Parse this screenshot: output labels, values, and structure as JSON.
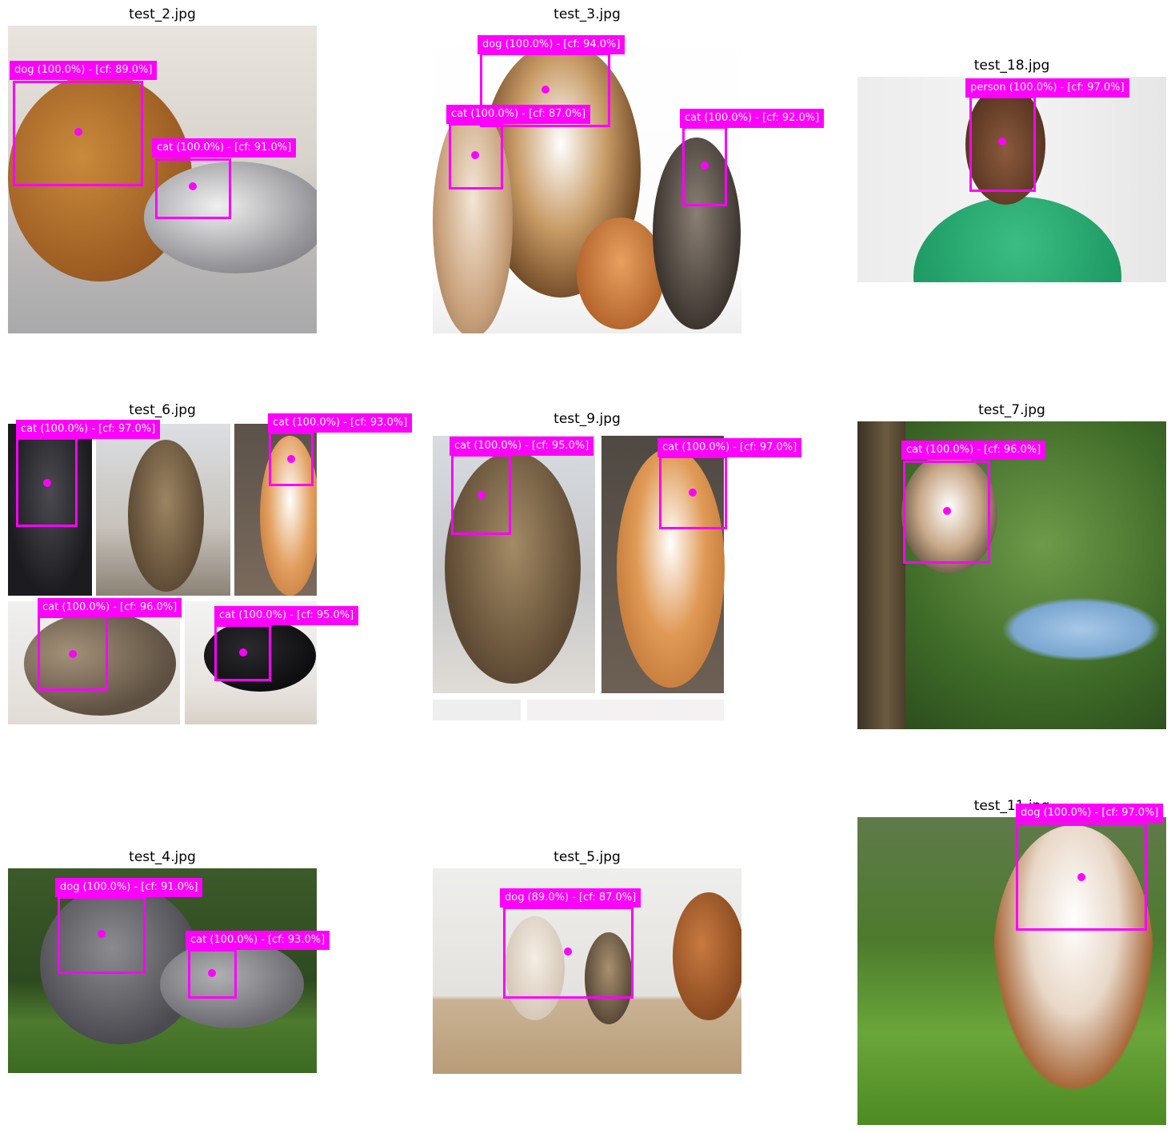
{
  "panels": [
    {
      "title": "test_2.jpg",
      "detections": [
        {
          "label": "dog (100.0%) - [cf: 89.0%]"
        },
        {
          "label": "cat (100.0%) - [cf: 91.0%]"
        }
      ]
    },
    {
      "title": "test_3.jpg",
      "detections": [
        {
          "label": "dog (100.0%) - [cf: 94.0%]"
        },
        {
          "label": "cat (100.0%) - [cf: 87.0%]"
        },
        {
          "label": "cat (100.0%) - [cf: 92.0%]"
        }
      ]
    },
    {
      "title": "test_18.jpg",
      "detections": [
        {
          "label": "person (100.0%) - [cf: 97.0%]"
        }
      ]
    },
    {
      "title": "test_6.jpg",
      "detections": [
        {
          "label": "cat (100.0%) - [cf: 97.0%]"
        },
        {
          "label": "cat (100.0%) - [cf: 93.0%]"
        },
        {
          "label": "cat (100.0%) - [cf: 96.0%]"
        },
        {
          "label": "cat (100.0%) - [cf: 95.0%]"
        }
      ]
    },
    {
      "title": "test_9.jpg",
      "detections": [
        {
          "label": "cat (100.0%) - [cf: 95.0%]"
        },
        {
          "label": "cat (100.0%) - [cf: 97.0%]"
        }
      ]
    },
    {
      "title": "test_7.jpg",
      "detections": [
        {
          "label": "cat (100.0%) - [cf: 96.0%]"
        }
      ]
    },
    {
      "title": "test_4.jpg",
      "detections": [
        {
          "label": "dog (100.0%) - [cf: 91.0%]"
        },
        {
          "label": "cat (100.0%) - [cf: 93.0%]"
        }
      ]
    },
    {
      "title": "test_5.jpg",
      "detections": [
        {
          "label": "dog (89.0%) - [cf: 87.0%]"
        }
      ]
    },
    {
      "title": "test_11.jpg",
      "detections": [
        {
          "label": "dog (100.0%) - [cf: 97.0%]"
        }
      ]
    }
  ],
  "colors": {
    "annotation": "#ff00ff",
    "label_text": "#ffffff"
  }
}
